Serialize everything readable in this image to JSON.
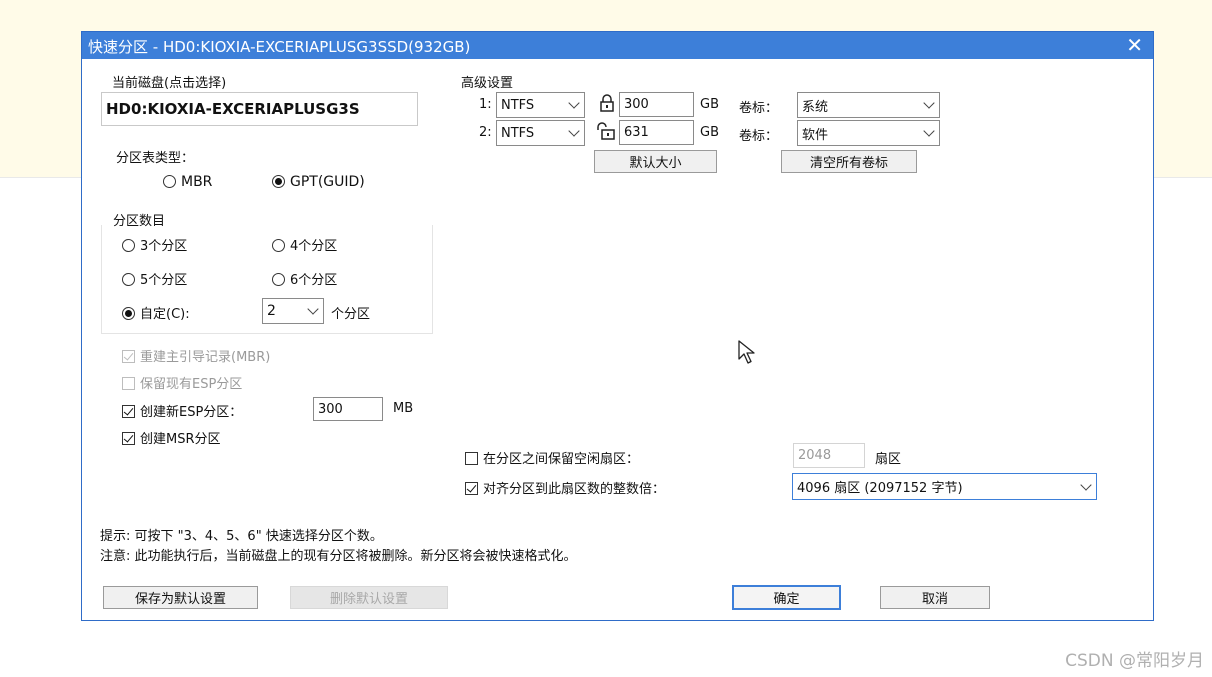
{
  "window": {
    "title": "快速分区 - HD0:KIOXIA-EXCERIAPLUSG3SSD(932GB)",
    "close": "✕"
  },
  "disk": {
    "label": "当前磁盘(点击选择)",
    "value": "HD0:KIOXIA-EXCERIAPLUSG3S"
  },
  "partition_table": {
    "label": "分区表类型：",
    "options": [
      {
        "label": "MBR",
        "selected": false
      },
      {
        "label": "GPT(GUID)",
        "selected": true
      }
    ]
  },
  "partition_count": {
    "label": "分区数目",
    "options": [
      {
        "label": "3个分区",
        "selected": false
      },
      {
        "label": "4个分区",
        "selected": false
      },
      {
        "label": "5个分区",
        "selected": false
      },
      {
        "label": "6个分区",
        "selected": false
      },
      {
        "label": "自定(C):",
        "selected": true
      }
    ],
    "custom_value": "2",
    "custom_suffix": "个分区"
  },
  "options": {
    "rebuild_mbr": {
      "label": "重建主引导记录(MBR)",
      "checked": true,
      "disabled": true
    },
    "keep_esp": {
      "label": "保留现有ESP分区",
      "checked": false,
      "disabled": true
    },
    "create_esp": {
      "label": "创建新ESP分区：",
      "checked": true,
      "size": "300",
      "unit": "MB"
    },
    "create_msr": {
      "label": "创建MSR分区",
      "checked": true
    }
  },
  "advanced": {
    "label": "高级设置",
    "partitions": [
      {
        "index": "1:",
        "fs": "NTFS",
        "lock_icon": "lock-icon",
        "size": "300",
        "unit": "GB",
        "volume_label_text": "卷标：",
        "volume_label": "系统"
      },
      {
        "index": "2:",
        "fs": "NTFS",
        "lock_icon": "unlock-icon",
        "size": "631",
        "unit": "GB",
        "volume_label_text": "卷标：",
        "volume_label": "软件"
      }
    ],
    "default_size_button": "默认大小",
    "clear_labels_button": "清空所有卷标"
  },
  "free_sectors": {
    "label": "在分区之间保留空闲扇区：",
    "checked": false,
    "value": "2048",
    "unit": "扇区"
  },
  "align": {
    "label": "对齐分区到此扇区数的整数倍：",
    "checked": true,
    "value": "4096 扇区 (2097152 字节)"
  },
  "tips": {
    "line1": "提示: 可按下 \"3、4、5、6\" 快速选择分区个数。",
    "line2": "注意: 此功能执行后，当前磁盘上的现有分区将被删除。新分区将会被快速格式化。"
  },
  "buttons": {
    "save_default": "保存为默认设置",
    "delete_default": "删除默认设置",
    "ok": "确定",
    "cancel": "取消"
  },
  "watermark": "CSDN @常阳岁月",
  "colors": {
    "titlebar": "#3d7fd9",
    "background_band": "#fffbe8"
  }
}
